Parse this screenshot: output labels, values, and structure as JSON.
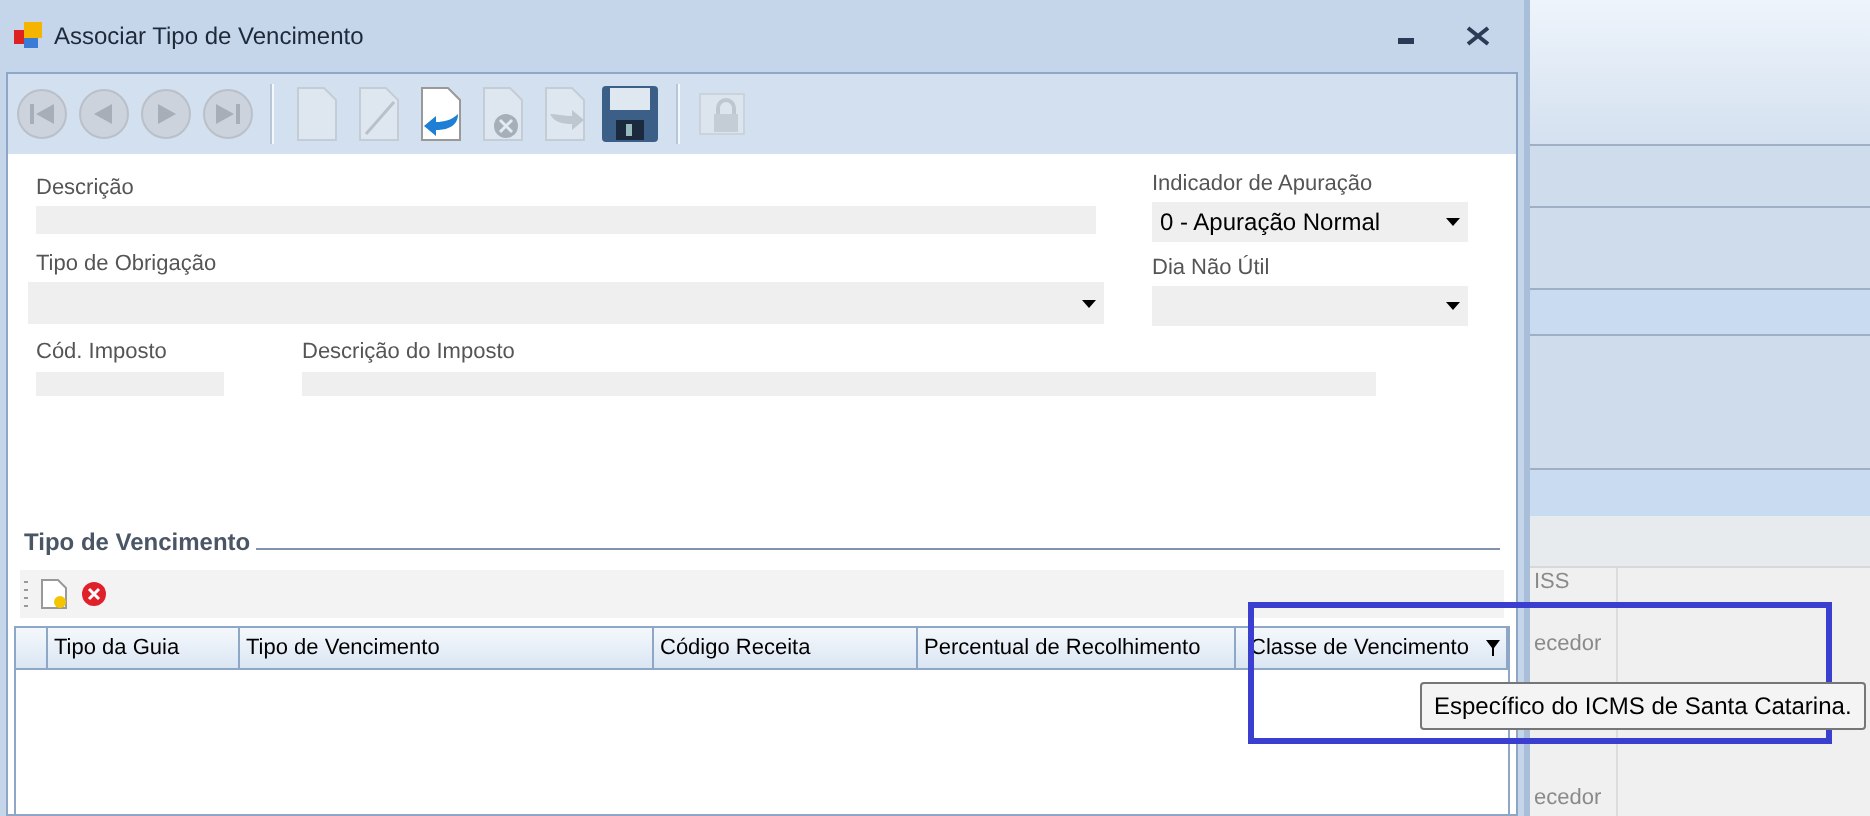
{
  "window": {
    "title": "Associar Tipo de Vencimento"
  },
  "toolbar": {
    "buttons": [
      {
        "kind": "first",
        "disabled": true
      },
      {
        "kind": "previous",
        "disabled": true
      },
      {
        "kind": "next",
        "disabled": true
      },
      {
        "kind": "last",
        "disabled": true
      },
      {
        "kind": "separator"
      },
      {
        "kind": "new",
        "disabled": true
      },
      {
        "kind": "edit",
        "disabled": true
      },
      {
        "kind": "undo",
        "disabled": false
      },
      {
        "kind": "delete",
        "disabled": true
      },
      {
        "kind": "redo",
        "disabled": true
      },
      {
        "kind": "save",
        "disabled": false
      },
      {
        "kind": "separator"
      },
      {
        "kind": "lock",
        "disabled": true
      }
    ]
  },
  "form": {
    "descricao": {
      "label": "Descrição"
    },
    "tipo_obrigacao": {
      "label": "Tipo de Obrigação"
    },
    "indicador_apuracao": {
      "label": "Indicador de Apuração",
      "value": "0 - Apuração Normal"
    },
    "dia_nao_util": {
      "label": "Dia Não Útil"
    },
    "cod_imposto": {
      "label": "Cód. Imposto"
    },
    "descricao_imposto": {
      "label": "Descrição do Imposto"
    }
  },
  "section": {
    "title": "Tipo de Vencimento"
  },
  "grid": {
    "columns": [
      "Tipo da Guia",
      "Tipo de Vencimento",
      "Código Receita",
      "Percentual de Recolhimento",
      "Classe de Vencimento"
    ]
  },
  "tooltip": "Específico do ICMS de Santa Catarina.",
  "background_cells": [
    "ISS",
    "ecedor",
    "ecedor"
  ]
}
